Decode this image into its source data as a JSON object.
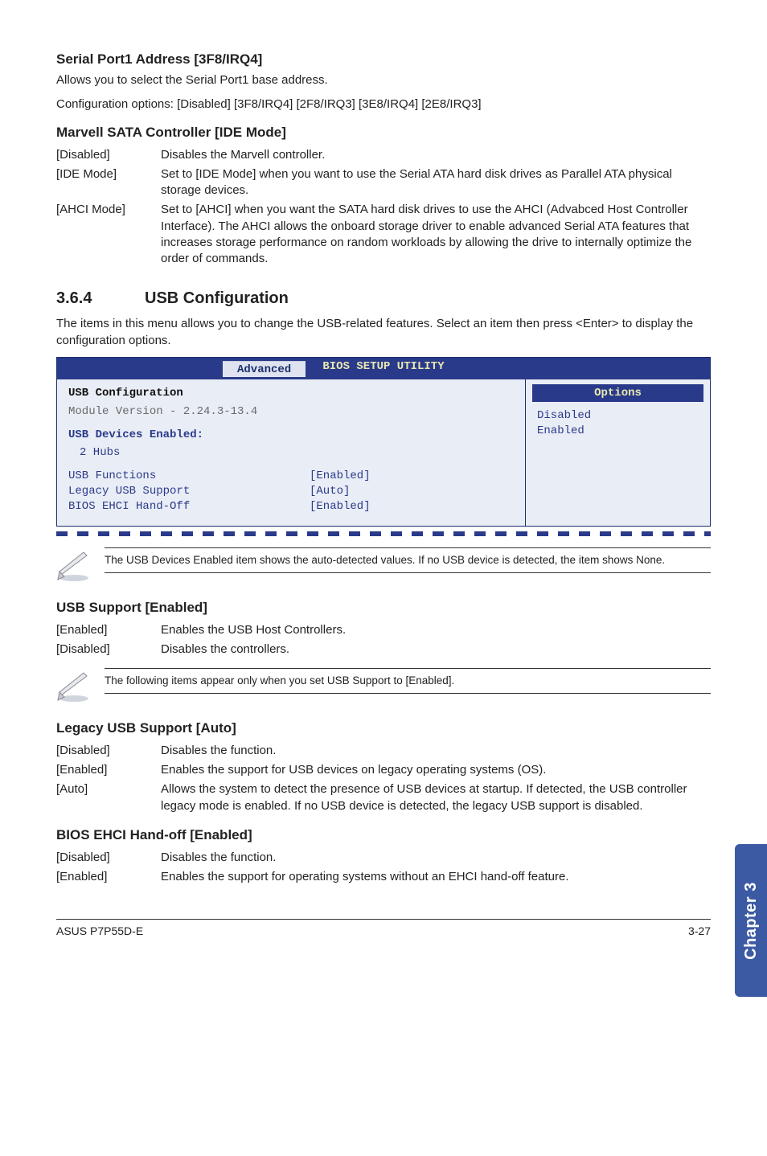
{
  "serialPort": {
    "heading": "Serial Port1 Address [3F8/IRQ4]",
    "line1": "Allows you to select the Serial Port1 base address.",
    "line2": "Configuration options: [Disabled] [3F8/IRQ4] [2F8/IRQ3] [3E8/IRQ4] [2E8/IRQ3]"
  },
  "marvell": {
    "heading": "Marvell SATA Controller [IDE Mode]",
    "rows": [
      {
        "k": "[Disabled]",
        "v": "Disables the Marvell controller."
      },
      {
        "k": "[IDE Mode]",
        "v": "Set to [IDE Mode] when you want to use the Serial ATA hard disk drives as Parallel ATA physical storage devices."
      },
      {
        "k": "[AHCI Mode]",
        "v": "Set to [AHCI] when you want the SATA hard disk drives to use the AHCI (Advabced Host Controller Interface). The AHCI allows the onboard storage driver to enable advanced Serial ATA features that increases storage performance on random workloads by allowing the drive to internally optimize the order of commands."
      }
    ]
  },
  "section364": {
    "num": "3.6.4",
    "title": "USB Configuration",
    "intro": "The items in this menu allows you to change the USB-related features. Select an item then press <Enter> to display the configuration options."
  },
  "bios": {
    "utilTitle": "BIOS SETUP UTILITY",
    "tab": "Advanced",
    "panelHeading": "USB Configuration",
    "moduleVersion": "Module Version - 2.24.3-13.4",
    "devicesEnabledLabel": "USB Devices Enabled:",
    "devicesEnabledValue": "2 Hubs",
    "items": [
      {
        "k": "USB Functions",
        "v": "[Enabled]"
      },
      {
        "k": "Legacy USB Support",
        "v": "[Auto]"
      },
      {
        "k": "BIOS EHCI Hand-Off",
        "v": "[Enabled]"
      }
    ],
    "optionsHeader": "Options",
    "options": [
      "Disabled",
      "Enabled"
    ]
  },
  "note1": "The USB Devices Enabled item shows the auto-detected values. If no USB device is detected, the item shows None.",
  "usbSupport": {
    "heading": "USB Support [Enabled]",
    "rows": [
      {
        "k": "[Enabled]",
        "v": "Enables the USB Host Controllers."
      },
      {
        "k": "[Disabled]",
        "v": "Disables the controllers."
      }
    ]
  },
  "note2": "The following items appear only when you set USB Support to [Enabled].",
  "legacy": {
    "heading": "Legacy USB Support [Auto]",
    "rows": [
      {
        "k": "[Disabled]",
        "v": "Disables the function."
      },
      {
        "k": "[Enabled]",
        "v": "Enables the support for USB devices on legacy operating systems (OS)."
      },
      {
        "k": "[Auto]",
        "v": "Allows the system to detect the presence of USB devices at startup. If detected, the USB controller legacy mode is enabled. If no USB device is detected, the legacy USB support is disabled."
      }
    ]
  },
  "ehci": {
    "heading": "BIOS EHCI Hand-off [Enabled]",
    "rows": [
      {
        "k": "[Disabled]",
        "v": "Disables the function."
      },
      {
        "k": "[Enabled]",
        "v": "Enables the support for operating systems without an EHCI hand-off feature."
      }
    ]
  },
  "sideTab": "Chapter 3",
  "footer": {
    "left": "ASUS P7P55D-E",
    "right": "3-27"
  }
}
